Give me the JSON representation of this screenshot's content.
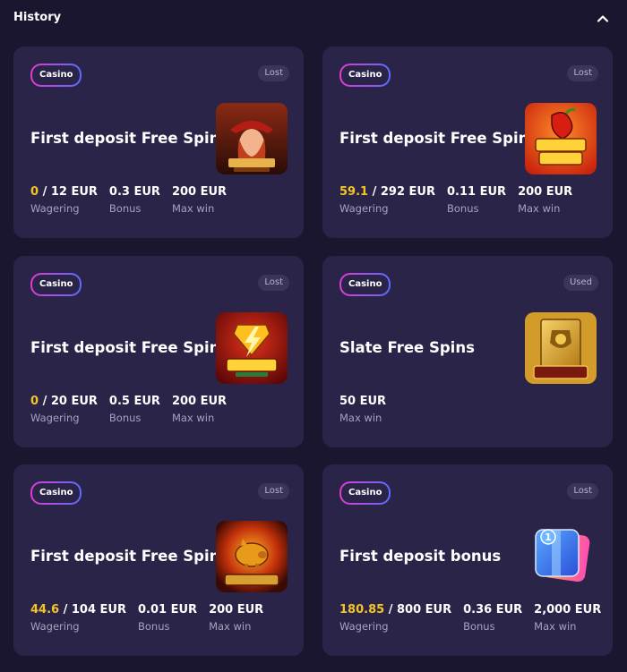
{
  "header": {
    "title": "History",
    "collapse_icon": "chevron-up-icon"
  },
  "cards": [
    {
      "badge": "Casino",
      "status": "Lost",
      "name": "First deposit Free Spins",
      "game_icon": "lucky-janes-egypt-game-icon",
      "wagering": {
        "current": "0",
        "total": "/ 12 EUR",
        "label": "Wagering"
      },
      "bonus": {
        "value": "0.3 EUR",
        "label": "Bonus"
      },
      "maxwin": {
        "value": "200 EUR",
        "label": "Max win"
      }
    },
    {
      "badge": "Casino",
      "status": "Lost",
      "name": "First deposit Free Spins",
      "game_icon": "chilli-coins-game-icon",
      "wagering": {
        "current": "59.1",
        "total": "/ 292 EUR",
        "label": "Wagering"
      },
      "bonus": {
        "value": "0.11 EUR",
        "label": "Bonus"
      },
      "maxwin": {
        "value": "200 EUR",
        "label": "Max win"
      }
    },
    {
      "badge": "Casino",
      "status": "Lost",
      "name": "First deposit Free Spins",
      "game_icon": "diamonds-power-game-icon",
      "wagering": {
        "current": "0",
        "total": "/ 20 EUR",
        "label": "Wagering"
      },
      "bonus": {
        "value": "0.5 EUR",
        "label": "Bonus"
      },
      "maxwin": {
        "value": "200 EUR",
        "label": "Max win"
      }
    },
    {
      "badge": "Casino",
      "status": "Used",
      "name": "Slate Free Spins",
      "game_icon": "book-of-gold-game-icon",
      "maxwin": {
        "value": "50 EUR",
        "label": "Max win"
      }
    },
    {
      "badge": "Casino",
      "status": "Lost",
      "name": "First deposit Free Spins",
      "game_icon": "royal-piggy-game-icon",
      "wagering": {
        "current": "44.6",
        "total": "/ 104 EUR",
        "label": "Wagering"
      },
      "bonus": {
        "value": "0.01 EUR",
        "label": "Bonus"
      },
      "maxwin": {
        "value": "200 EUR",
        "label": "Max win"
      }
    },
    {
      "badge": "Casino",
      "status": "Lost",
      "name": "First deposit bonus",
      "game_icon": "bonus-box-icon",
      "wagering": {
        "current": "180.85",
        "total": "/ 800 EUR",
        "label": "Wagering"
      },
      "bonus": {
        "value": "0.36 EUR",
        "label": "Bonus"
      },
      "maxwin": {
        "value": "2,000 EUR",
        "label": "Max win"
      }
    }
  ],
  "colors": {
    "background": "#1b1630",
    "card": "#2b2449",
    "highlight": "#f3c625",
    "muted": "#a7a2bd"
  }
}
